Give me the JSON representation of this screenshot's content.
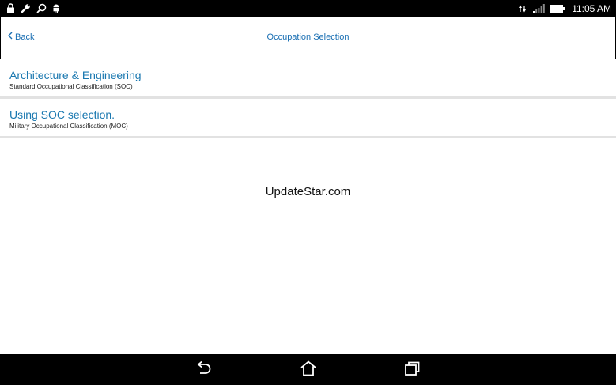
{
  "status_bar": {
    "left_icons": [
      "lock-icon",
      "wrench-icon",
      "search-icon",
      "android-icon"
    ],
    "right_icons": [
      "data-activity-icon",
      "signal-icon",
      "battery-icon"
    ],
    "time": "11:05 AM"
  },
  "header": {
    "back_label": "Back",
    "title": "Occupation Selection"
  },
  "list": {
    "items": [
      {
        "title": "Architecture & Engineering",
        "subtitle": "Standard Occupational Classification (SOC)"
      },
      {
        "title": "Using SOC selection.",
        "subtitle": "Military Occupational Classification (MOC)"
      }
    ]
  },
  "watermark": "UpdateStar.com",
  "nav_bar": {
    "buttons": [
      "back-icon",
      "home-icon",
      "recent-apps-icon"
    ]
  },
  "colors": {
    "accent": "#1a6fb3",
    "divider": "#e2e2e2",
    "bars": "#000000"
  }
}
